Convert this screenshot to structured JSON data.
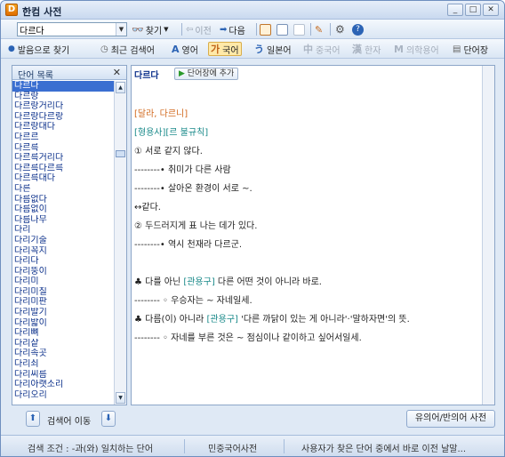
{
  "window": {
    "app_icon": "D",
    "title": "한컴 사전"
  },
  "window_buttons": {
    "minimize": "_",
    "maximize": "□",
    "close": "✕"
  },
  "toolbar": {
    "search_value": "다르다",
    "search_label": "찾기",
    "prev_label": "이전",
    "next_label": "다음"
  },
  "tabs": [
    {
      "label": "발음으로 찾기",
      "icon": "speaker-icon"
    },
    {
      "label": "최근 검색어",
      "icon": "clock-icon"
    },
    {
      "label": "영어",
      "glyph": "A",
      "icon": "english-icon"
    },
    {
      "label": "국어",
      "glyph": "가",
      "icon": "korean-icon"
    },
    {
      "label": "일본어",
      "glyph": "う",
      "icon": "japanese-icon"
    },
    {
      "label": "중국어",
      "glyph": "中",
      "icon": "chinese-icon"
    },
    {
      "label": "한자",
      "glyph": "漢",
      "icon": "hanja-icon"
    },
    {
      "label": "의학용어",
      "glyph": "M",
      "icon": "medical-icon"
    },
    {
      "label": "단어장",
      "icon": "vocabulary-icon"
    }
  ],
  "word_list": {
    "title": "단어 목록",
    "close": "✕",
    "items": [
      "다르다",
      "다르랑",
      "다르랑거리다",
      "다르랑다르랑",
      "다르랑대다",
      "다르르",
      "다르륵",
      "다르륵거리다",
      "다르륵다르륵",
      "다르륵대다",
      "다른",
      "다름없다",
      "다름없이",
      "다름나무",
      "다리",
      "다리기술",
      "다리꼭지",
      "다리다",
      "다리뚱이",
      "다리미",
      "다리미질",
      "다리미판",
      "다리발기",
      "다리밟이",
      "다리뼈",
      "다리샅",
      "다리속곳",
      "다리쇠",
      "다리씨름",
      "다리아랫소리",
      "다리오리"
    ],
    "selected_index": 0
  },
  "entry": {
    "word": "다르다",
    "add_button": "단어장에 추가",
    "pronunciation": "[달라, 다르니]",
    "pos": "[형용사][르 불규칙]",
    "lines": [
      "① 서로 같지 않다.",
      "--------• 취미가 다른 사람",
      "--------• 살아온 환경이 서로 ~.",
      "↔같다.",
      "② 두드러지게 표 나는 데가 있다.",
      "--------• 역시 천재라 다르군.",
      "",
      "♣ 다를 아닌 [관용구] 다른 어떤 것이 아니라 바로.",
      "-------- ◦ 우승자는 ~ 자네일세.",
      "♣ 다름(이) 아니라 [관용구] '다른 까닭이 있는 게 아니라'·'말하자면'의 뜻.",
      "-------- ◦ 자네를 부른 것은 ~ 점심이나 같이하고 싶어서일세."
    ]
  },
  "bottom": {
    "move_label": "검색어 이동",
    "synonym_button": "유의어/반의어 사전"
  },
  "status": {
    "condition": "검색 조건 : -과(와) 일치하는 단어",
    "dictionary": "민중국어사전",
    "hint": "사용자가 찾은 단어 중에서 바로 이전 날말..."
  }
}
